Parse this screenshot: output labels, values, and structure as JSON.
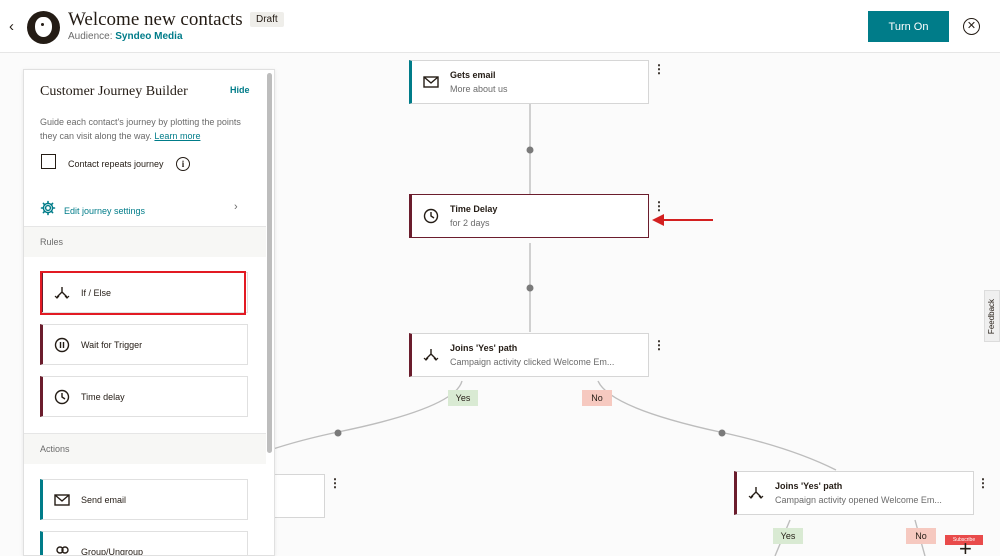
{
  "header": {
    "title": "Welcome new contacts",
    "badge": "Draft",
    "audience_label": "Audience:",
    "audience_value": "Syndeo Media",
    "turn_on": "Turn On",
    "close_glyph": "✕",
    "back_glyph": "‹"
  },
  "sidebar": {
    "title": "Customer Journey Builder",
    "hide": "Hide",
    "description": "Guide each contact's journey by plotting the points they can visit along the way.",
    "learn_more": "Learn more",
    "repeat_label": "Contact repeats journey",
    "info_glyph": "i",
    "settings_label": "Edit journey settings",
    "chevron": "›",
    "rules_header": "Rules",
    "rules": [
      {
        "label": "If / Else",
        "icon": "split-icon"
      },
      {
        "label": "Wait for Trigger",
        "icon": "pause-icon"
      },
      {
        "label": "Time delay",
        "icon": "clock-icon"
      }
    ],
    "actions_header": "Actions",
    "actions": [
      {
        "label": "Send email",
        "icon": "envelope-icon"
      },
      {
        "label": "Group/Ungroup",
        "icon": "group-icon"
      }
    ]
  },
  "flow": {
    "nodes": [
      {
        "title": "Gets email",
        "subtitle": "More about us",
        "icon": "envelope-icon"
      },
      {
        "title": "Time Delay",
        "subtitle": "for 2 days",
        "icon": "clock-icon"
      },
      {
        "title": "Joins 'Yes' path",
        "subtitle": "Campaign activity clicked Welcome Em...",
        "icon": "split-icon"
      },
      {
        "title": "Joins 'Yes' path",
        "subtitle": "Campaign activity opened Welcome Em...",
        "icon": "split-icon"
      }
    ],
    "branch_yes": "Yes",
    "branch_no": "No",
    "kebab": "⋮"
  },
  "feedback": "Feedback",
  "subscribe": "Subscribe",
  "plus": "+",
  "colors": {
    "accent": "#007c89",
    "rule": "#6b1d2d",
    "highlight": "#e21a23",
    "yes": "#d9ead3",
    "no": "#f6c9c0"
  }
}
